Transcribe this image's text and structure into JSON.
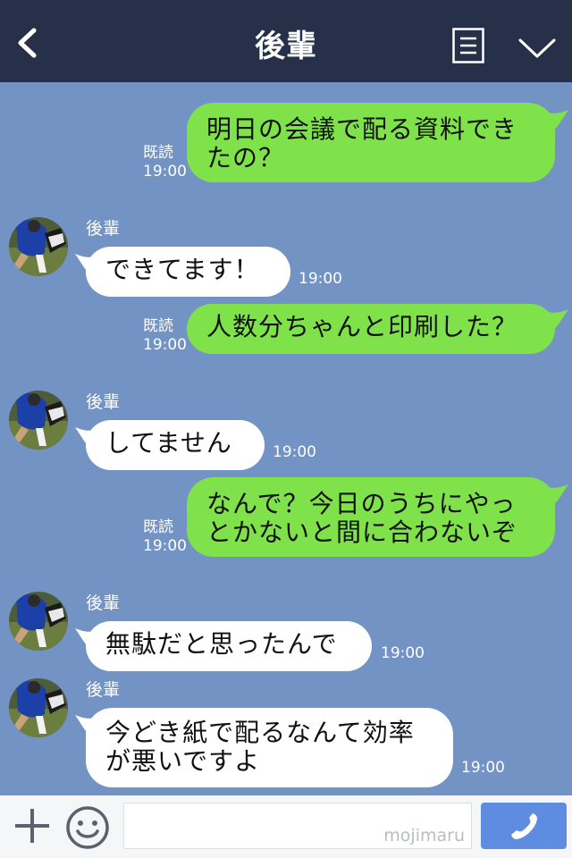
{
  "header": {
    "title": "後輩",
    "back_icon": "chevron-left-icon",
    "menu_icon": "list-icon",
    "collapse_icon": "chevron-down-icon"
  },
  "messages": [
    {
      "direction": "sent",
      "text": "明日の会議で配る資料でき\nたの？",
      "read": "既読",
      "time": "19:00"
    },
    {
      "direction": "received",
      "sender": "後輩",
      "text": "できてます！",
      "time": "19:00"
    },
    {
      "direction": "sent",
      "text": "人数分ちゃんと印刷した？",
      "read": "既読",
      "time": "19:00"
    },
    {
      "direction": "received",
      "sender": "後輩",
      "text": "してません",
      "time": "19:00"
    },
    {
      "direction": "sent",
      "text": "なんで？今日のうちにやっ\nとかないと間に合わないぞ",
      "read": "既読",
      "time": "19:00"
    },
    {
      "direction": "received",
      "sender": "後輩",
      "text": "無駄だと思ったんで",
      "time": "19:00"
    },
    {
      "direction": "received",
      "sender": "後輩",
      "text": "今どき紙で配るなんて効率\nが悪いですよ",
      "time": "19:00"
    }
  ],
  "footer": {
    "plus_icon": "plus-icon",
    "sticker_icon": "smile-icon",
    "watermark": "mojimaru",
    "call_icon": "phone-icon"
  },
  "colors": {
    "header_bg": "#263149",
    "chat_bg": "#7293c4",
    "sent_bubble": "#80e24a",
    "received_bubble": "#ffffff",
    "call_button": "#5d8ce0"
  }
}
